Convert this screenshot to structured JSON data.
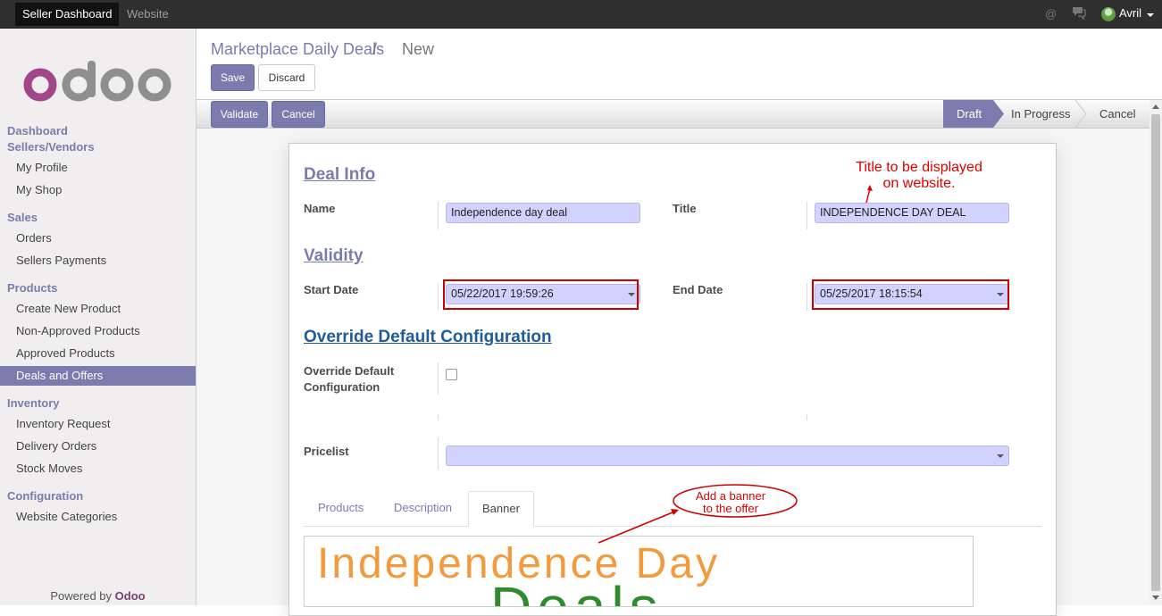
{
  "topbar": {
    "apps": [
      "Seller Dashboard",
      "Website"
    ],
    "user": "Avril",
    "icons": [
      "at-icon",
      "chat-icon"
    ]
  },
  "logo_text": "odoo",
  "sidebar": {
    "sections": [
      {
        "title": "Dashboard",
        "items": []
      },
      {
        "title": "Sellers/Vendors",
        "items": [
          "My Profile",
          "My Shop"
        ]
      },
      {
        "title": "Sales",
        "items": [
          "Orders",
          "Sellers Payments"
        ]
      },
      {
        "title": "Products",
        "items": [
          "Create New Product",
          "Non-Approved Products",
          "Approved Products",
          "Deals and Offers"
        ]
      },
      {
        "title": "Inventory",
        "items": [
          "Inventory Request",
          "Delivery Orders",
          "Stock Moves"
        ]
      },
      {
        "title": "Configuration",
        "items": [
          "Website Categories"
        ]
      }
    ],
    "active_item": "Deals and Offers",
    "powered_by": "Powered by",
    "powered_brand": "Odoo"
  },
  "breadcrumb": {
    "parent": "Marketplace Daily Deals",
    "separator": "/",
    "current": "New"
  },
  "control_buttons": {
    "save": "Save",
    "discard": "Discard"
  },
  "action_buttons": {
    "validate": "Validate",
    "cancel": "Cancel"
  },
  "stages": [
    "Draft",
    "In Progress",
    "Cancel"
  ],
  "active_stage": "Draft",
  "form": {
    "deal_info": {
      "heading": "Deal Info",
      "name_label": "Name",
      "name_value": "Independence day deal",
      "title_label": "Title",
      "title_value": "INDEPENDENCE DAY DEAL"
    },
    "validity": {
      "heading": "Validity",
      "start_label": "Start Date",
      "start_value": "05/22/2017 19:59:26",
      "end_label": "End Date",
      "end_value": "05/25/2017 18:15:54"
    },
    "override": {
      "heading": "Override Default Configuration",
      "label_line1": "Override Default",
      "label_line2": "Configuration",
      "checked": false
    },
    "pricelist": {
      "label": "Pricelist",
      "value": ""
    },
    "tabs": [
      "Products",
      "Description",
      "Banner"
    ],
    "active_tab": "Banner",
    "banner": {
      "line1": "Independence Day",
      "line2": "Deals"
    }
  },
  "annotations": {
    "title_note_line1": "Title to be displayed",
    "title_note_line2": "on website.",
    "banner_note_line1": "Add a banner",
    "banner_note_line2": "to the offer"
  },
  "colors": {
    "accent": "#7c7bad",
    "topbar": "#2f2f2f",
    "annotation": "#d00000",
    "input_bg": "#d2d2ff",
    "logo_purple": "#a24689",
    "logo_grey": "#8f8f8f"
  }
}
